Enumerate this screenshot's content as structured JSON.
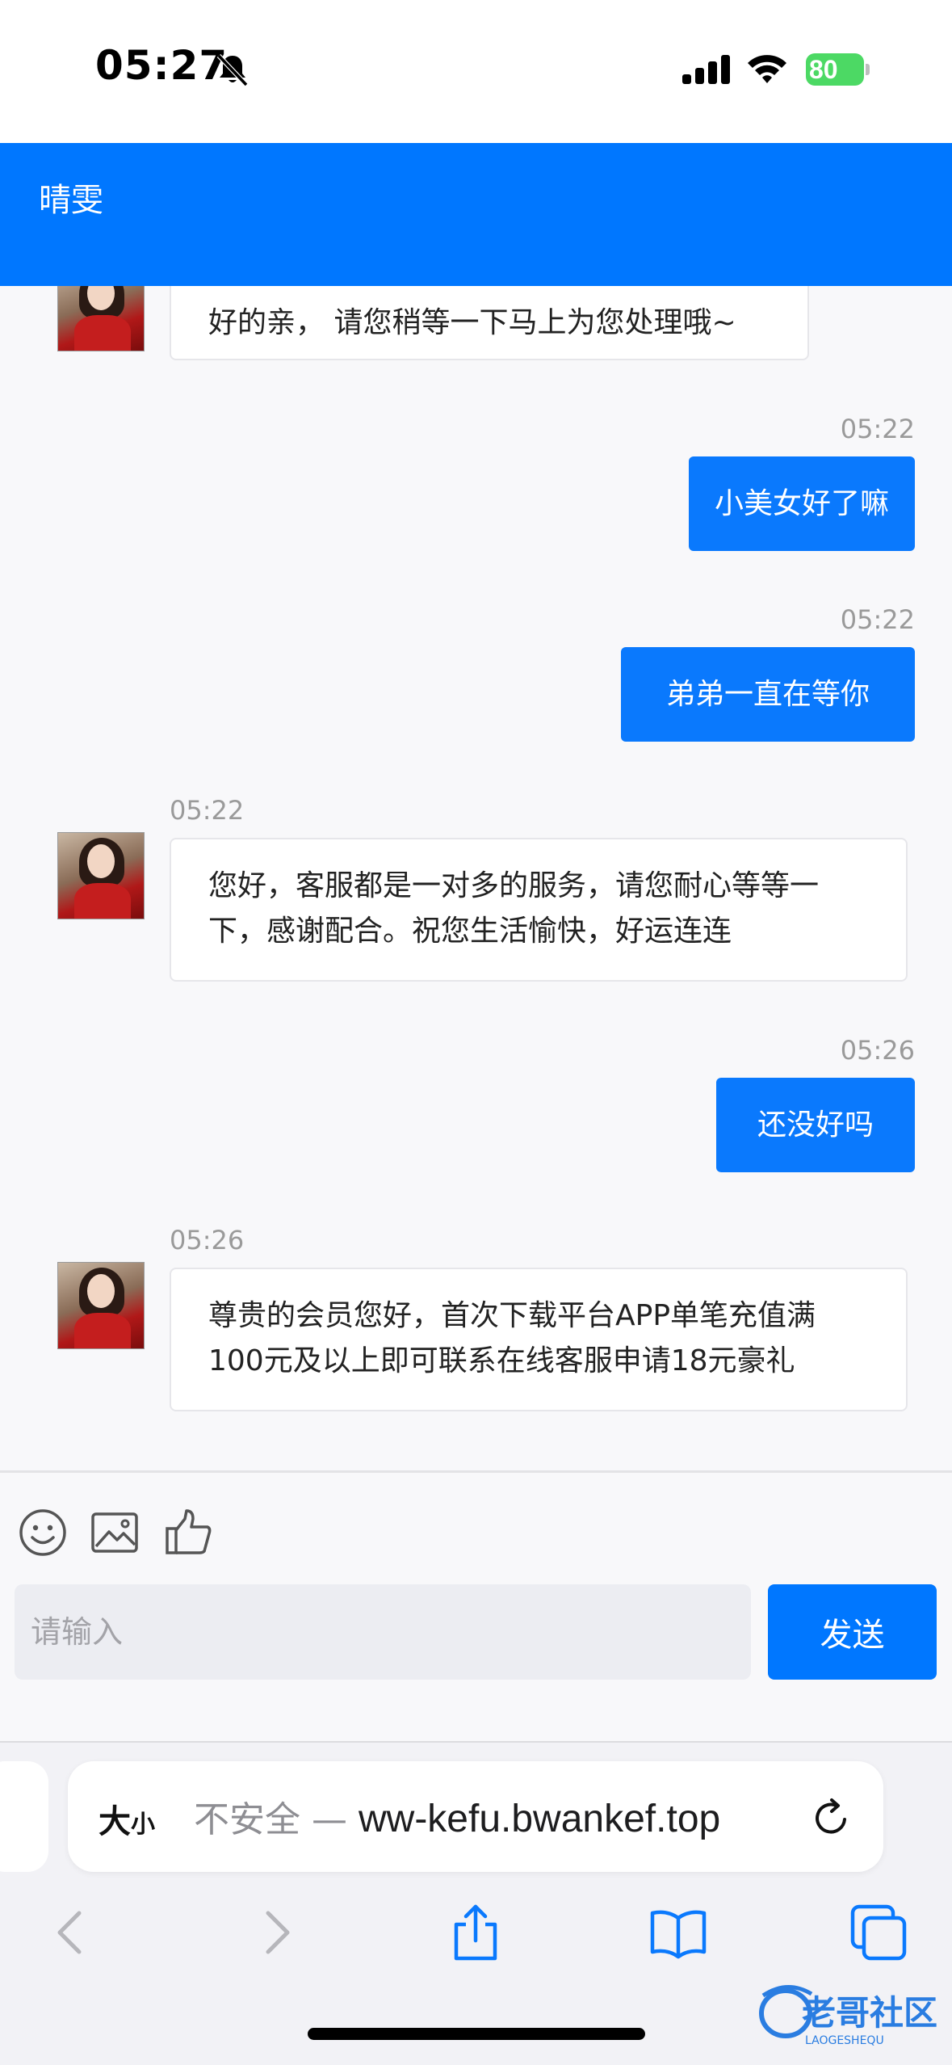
{
  "status_bar": {
    "time": "05:27",
    "battery": "80"
  },
  "header": {
    "title": "晴雯"
  },
  "messages": [
    {
      "dir": "in",
      "time": "",
      "text": "好的亲， 请您稍等一下马上为您处理哦~"
    },
    {
      "dir": "out",
      "time": "05:22",
      "text": "小美女好了嘛"
    },
    {
      "dir": "out",
      "time": "05:22",
      "text": "弟弟一直在等你"
    },
    {
      "dir": "in",
      "time": "05:22",
      "lines": [
        "您好，客服都是一对多的服务，请您耐心等等一",
        "下，感谢配合。祝您生活愉快，好运连连"
      ]
    },
    {
      "dir": "out",
      "time": "05:26",
      "text": "还没好吗"
    },
    {
      "dir": "in",
      "time": "05:26",
      "lines": [
        "尊贵的会员您好，首次下载平台APP单笔充值满",
        "100元及以上即可联系在线客服申请18元豪礼"
      ]
    }
  ],
  "composer": {
    "placeholder": "请输入",
    "send_label": "发送"
  },
  "safari": {
    "aa_big": "大",
    "aa_small": "小",
    "insecure_label": "不安全 — ",
    "url": "ww-kefu.bwankef.top"
  },
  "watermark": {
    "text": "老哥社区",
    "sub": "LAOGESHEQU"
  },
  "colors": {
    "accent": "#0077ff",
    "bubble_out": "#0a79fd",
    "battery": "#4cd964"
  }
}
